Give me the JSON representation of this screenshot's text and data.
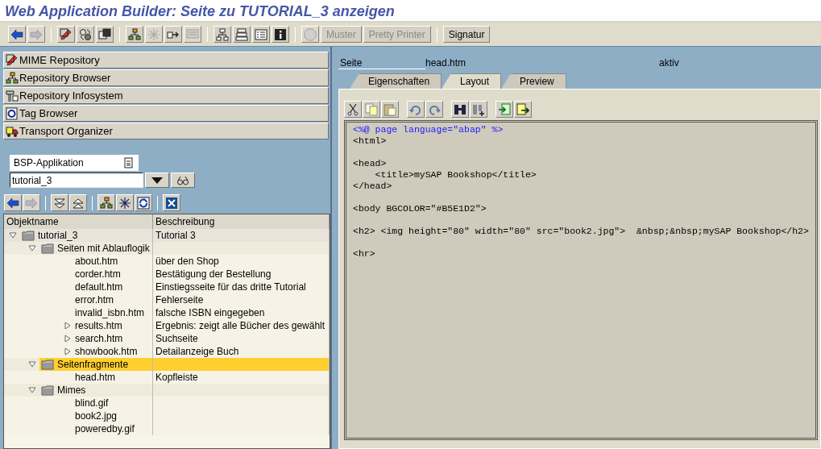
{
  "window": {
    "title": "Web Application Builder: Seite zu TUTORIAL_3 anzeigen"
  },
  "toolbar": [
    {
      "kind": "icon",
      "disabled": false
    },
    {
      "kind": "icon",
      "disabled": true
    },
    {
      "kind": "separator"
    },
    {
      "kind": "icon",
      "disabled": false
    },
    {
      "kind": "icon",
      "disabled": false
    },
    {
      "kind": "icon",
      "disabled": false
    },
    {
      "kind": "separator"
    },
    {
      "kind": "icon",
      "disabled": false
    },
    {
      "kind": "icon",
      "disabled": true
    },
    {
      "kind": "icon",
      "disabled": false
    },
    {
      "kind": "icon",
      "disabled": true
    },
    {
      "kind": "separator"
    },
    {
      "kind": "icon",
      "disabled": false
    },
    {
      "kind": "icon",
      "disabled": false
    },
    {
      "kind": "icon",
      "disabled": false
    },
    {
      "kind": "icon",
      "disabled": false
    },
    {
      "kind": "separator"
    },
    {
      "kind": "icon",
      "disabled": true
    },
    {
      "kind": "text",
      "label": "Muster",
      "disabled": true
    },
    {
      "kind": "text",
      "label": "Pretty Printer",
      "disabled": true
    },
    {
      "kind": "separator"
    },
    {
      "kind": "text",
      "label": "Signatur",
      "disabled": false
    }
  ],
  "navigator": {
    "items": [
      {
        "label": "MIME Repository"
      },
      {
        "label": "Repository Browser"
      },
      {
        "label": "Repository Infosystem"
      },
      {
        "label": "Tag Browser"
      },
      {
        "label": "Transport Organizer"
      }
    ]
  },
  "object_selector": {
    "type": "BSP-Applikation",
    "value": "tutorial_3"
  },
  "tree_toolbar": [
    {
      "kind": "icon",
      "disabled": false
    },
    {
      "kind": "icon",
      "disabled": true
    },
    {
      "kind": "separator"
    },
    {
      "kind": "icon",
      "disabled": false
    },
    {
      "kind": "icon",
      "disabled": false
    },
    {
      "kind": "separator"
    },
    {
      "kind": "icon",
      "disabled": false
    },
    {
      "kind": "icon",
      "disabled": false
    },
    {
      "kind": "icon",
      "disabled": false
    },
    {
      "kind": "separator"
    },
    {
      "kind": "icon",
      "disabled": false
    }
  ],
  "tree": {
    "columns": [
      "Objektname",
      "Beschreibung"
    ],
    "rows": [
      {
        "name": "tutorial_3",
        "description": "Tutorial 3",
        "kind": "folder",
        "expanded": true,
        "selected": false,
        "children": [
          {
            "name": "Seiten mit Ablauflogik",
            "kind": "folder",
            "expanded": true,
            "selected": false,
            "children": [
              {
                "name": "about.htm",
                "description": "über den Shop",
                "kind": "leaf",
                "selected": false
              },
              {
                "name": "corder.htm",
                "description": "Bestätigung der Bestellung",
                "kind": "leaf",
                "selected": false
              },
              {
                "name": "default.htm",
                "description": "Einstiegsseite für das dritte Tutorial",
                "kind": "leaf",
                "selected": false
              },
              {
                "name": "error.htm",
                "description": "Fehlerseite",
                "kind": "leaf",
                "selected": false
              },
              {
                "name": "invalid_isbn.htm",
                "description": "falsche ISBN eingegeben",
                "kind": "leaf",
                "selected": false
              },
              {
                "name": "results.htm",
                "description": "Ergebnis: zeigt alle Bücher des gewählt",
                "kind": "node",
                "expanded": false,
                "selected": false
              },
              {
                "name": "search.htm",
                "description": "Suchseite",
                "kind": "node",
                "expanded": false,
                "selected": false
              },
              {
                "name": "showbook.htm",
                "description": "Detailanzeige Buch",
                "kind": "node",
                "expanded": false,
                "selected": false
              }
            ]
          },
          {
            "name": "Seitenfragmente",
            "kind": "folder",
            "expanded": true,
            "selected": true,
            "children": [
              {
                "name": "head.htm",
                "description": "Kopfleiste",
                "kind": "leaf",
                "selected": false
              }
            ]
          },
          {
            "name": "Mimes",
            "kind": "folder",
            "expanded": true,
            "selected": false,
            "children": [
              {
                "name": "blind.gif",
                "kind": "leaf",
                "selected": false
              },
              {
                "name": "book2.jpg",
                "kind": "leaf",
                "selected": false
              },
              {
                "name": "poweredby.gif",
                "kind": "leaf",
                "selected": false
              }
            ]
          }
        ]
      }
    ]
  },
  "page_header": {
    "label": "Seite",
    "name": "head.htm",
    "status": "aktiv"
  },
  "tabs": [
    {
      "label": "Eigenschaften",
      "selected": false
    },
    {
      "label": "Layout",
      "selected": true
    },
    {
      "label": "Preview",
      "selected": false
    }
  ],
  "editor_toolbar": [
    {
      "kind": "icon",
      "disabled": false
    },
    {
      "kind": "icon",
      "disabled": false
    },
    {
      "kind": "icon",
      "disabled": false
    },
    {
      "kind": "separator"
    },
    {
      "kind": "icon",
      "disabled": false
    },
    {
      "kind": "icon",
      "disabled": false
    },
    {
      "kind": "separator"
    },
    {
      "kind": "icon",
      "disabled": false
    },
    {
      "kind": "icon",
      "disabled": false
    },
    {
      "kind": "separator"
    },
    {
      "kind": "icon",
      "disabled": false
    },
    {
      "kind": "icon",
      "disabled": false
    }
  ],
  "editor": {
    "lines": [
      {
        "text": "<%@ page language=\"abap\" %>",
        "kind": "directive",
        "gap_before": false
      },
      {
        "text": "<html>",
        "kind": "markup",
        "gap_before": false
      },
      {
        "text": "<head>",
        "kind": "markup",
        "gap_before": true
      },
      {
        "text": "    <title>mySAP Bookshop</title>",
        "kind": "markup",
        "gap_before": false
      },
      {
        "text": "</head>",
        "kind": "markup",
        "gap_before": false
      },
      {
        "text": "<body BGCOLOR=\"#B5E1D2\">",
        "kind": "markup",
        "gap_before": true
      },
      {
        "text": "<h2> <img height=\"80\" width=\"80\" src=\"book2.jpg\">  &nbsp;&nbsp;mySAP Bookshop</h2>",
        "kind": "markup",
        "gap_before": true
      },
      {
        "text": "<hr>",
        "kind": "markup",
        "gap_before": true
      }
    ]
  }
}
